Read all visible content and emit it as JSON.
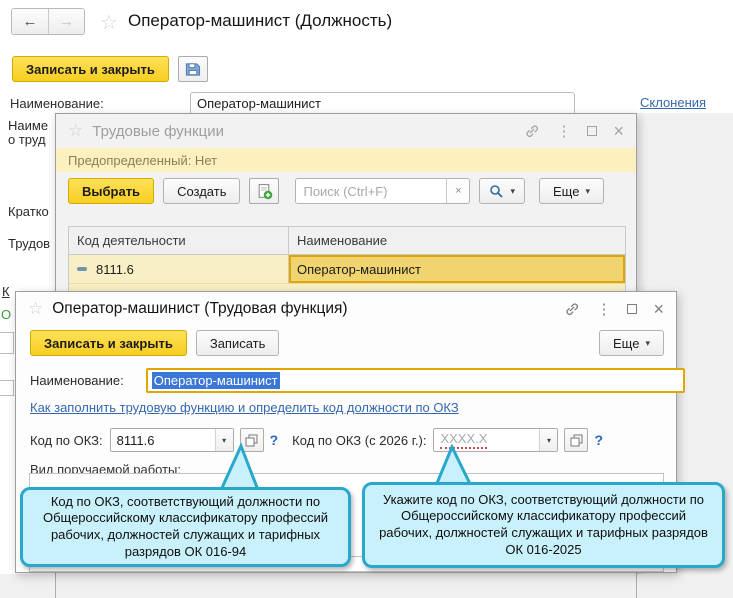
{
  "main_window": {
    "title": "Оператор-машинист (Должность)",
    "toolbar": {
      "save_close": "Записать и закрыть"
    },
    "fields": {
      "name_label": "Наименование:",
      "name_value": "Оператор-машинист",
      "declensions_link": "Склонения"
    },
    "fragments": [
      "Наиме",
      "о труд",
      "Кратко",
      "Трудов",
      "К",
      "О"
    ]
  },
  "functions_window": {
    "title": "Трудовые функции",
    "predefined_banner": "Предопределенный: Нет",
    "toolbar": {
      "select": "Выбрать",
      "create": "Создать",
      "search_placeholder": "Поиск (Ctrl+F)",
      "more": "Еще"
    },
    "table": {
      "columns": [
        "Код деятельности",
        "Наименование"
      ],
      "rows": [
        {
          "code": "8111.6",
          "name": "Оператор-машинист"
        }
      ]
    }
  },
  "function_window": {
    "title": "Оператор-машинист (Трудовая функция)",
    "toolbar": {
      "save_close": "Записать и закрыть",
      "save": "Записать",
      "more": "Еще"
    },
    "name_label": "Наименование:",
    "name_value": "Оператор-машинист",
    "help_link": "Как заполнить трудовую функцию и определить код должности по ОКЗ",
    "okz_label": "Код по ОКЗ:",
    "okz_value": "8111.6",
    "okz2026_label": "Код по ОКЗ (с 2026 г.):",
    "okz2026_placeholder": "XXXX.X",
    "help_mark": "?",
    "work_type_label": "Вид поручаемой работы:"
  },
  "tooltips": {
    "okz": "Код по ОКЗ, соответствующий должности по Общероссийскому классификатору профессий рабочих, должностей служащих и тарифных разрядов ОК 016-94",
    "okz2026": "Укажите код по ОКЗ, соответствующий должности по Общероссийскому классификатору профессий рабочих, должностей служащих и тарифных разрядов ОК 016-2025"
  },
  "colors": {
    "accent_yellow": "#F7CE22",
    "selected_cell": "#EFD46F",
    "banner_yellow": "#FBF0BE",
    "tooltip_fill": "#C9F1FB",
    "tooltip_border": "#2AA8CC",
    "selection_blue": "#3B77D6",
    "link_blue": "#3567B0"
  }
}
